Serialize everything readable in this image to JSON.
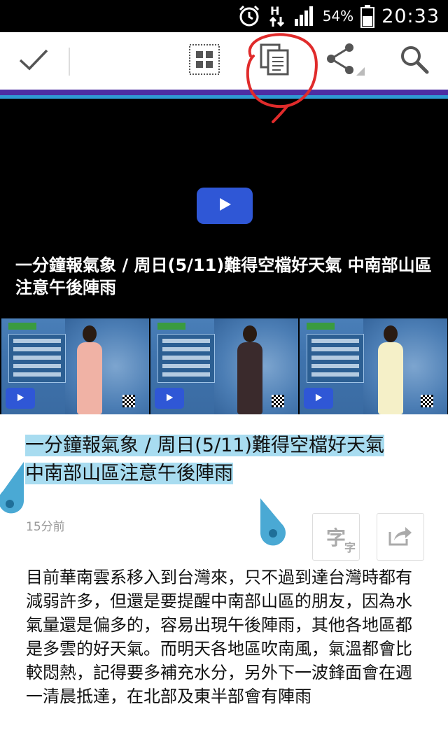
{
  "status_bar": {
    "battery_percent": "54%",
    "time": "20:33",
    "network_type": "H",
    "icons": [
      "alarm-clock-icon",
      "hspa-data-icon",
      "signal-icon",
      "battery-icon"
    ]
  },
  "toolbar": {
    "icons": [
      "check-icon",
      "grid-icon",
      "copy-icon",
      "share-icon",
      "search-icon"
    ],
    "accent_color": "#4d2ea3",
    "accent_color_2": "#2f9ad3"
  },
  "video": {
    "title": "一分鐘報氣象 / 周日(5/11)難得空檔好天氣 中南部山區注意午後陣雨",
    "play_color": "#2f57d6"
  },
  "thumbnails": [
    {
      "dress_color": "#f0b2a5"
    },
    {
      "dress_color": "#3a2a2c"
    },
    {
      "dress_color": "#f5f0c8"
    }
  ],
  "article": {
    "title_line1": "一分鐘報氣象 / 周日(5/11)難得空檔好天氣",
    "title_line2": "中南部山區注意午後陣雨",
    "time_ago": "15分前",
    "font_button_label": "字",
    "font_button_sub": "字",
    "body": "目前華南雲系移入到台灣來，只不過到達台灣時都有減弱許多，但還是要提醒中南部山區的朋友，因為水氣量還是偏多的，容易出現午後陣雨，其他各地區都是多雲的好天氣。而明天各地區吹南風，氣溫都會比較悶熱，記得要多補充水分，另外下一波鋒面會在週一清晨抵達，在北部及東半部會有陣雨"
  },
  "selection_color": "#a8dcf0",
  "annotation_color": "#e02b2b"
}
